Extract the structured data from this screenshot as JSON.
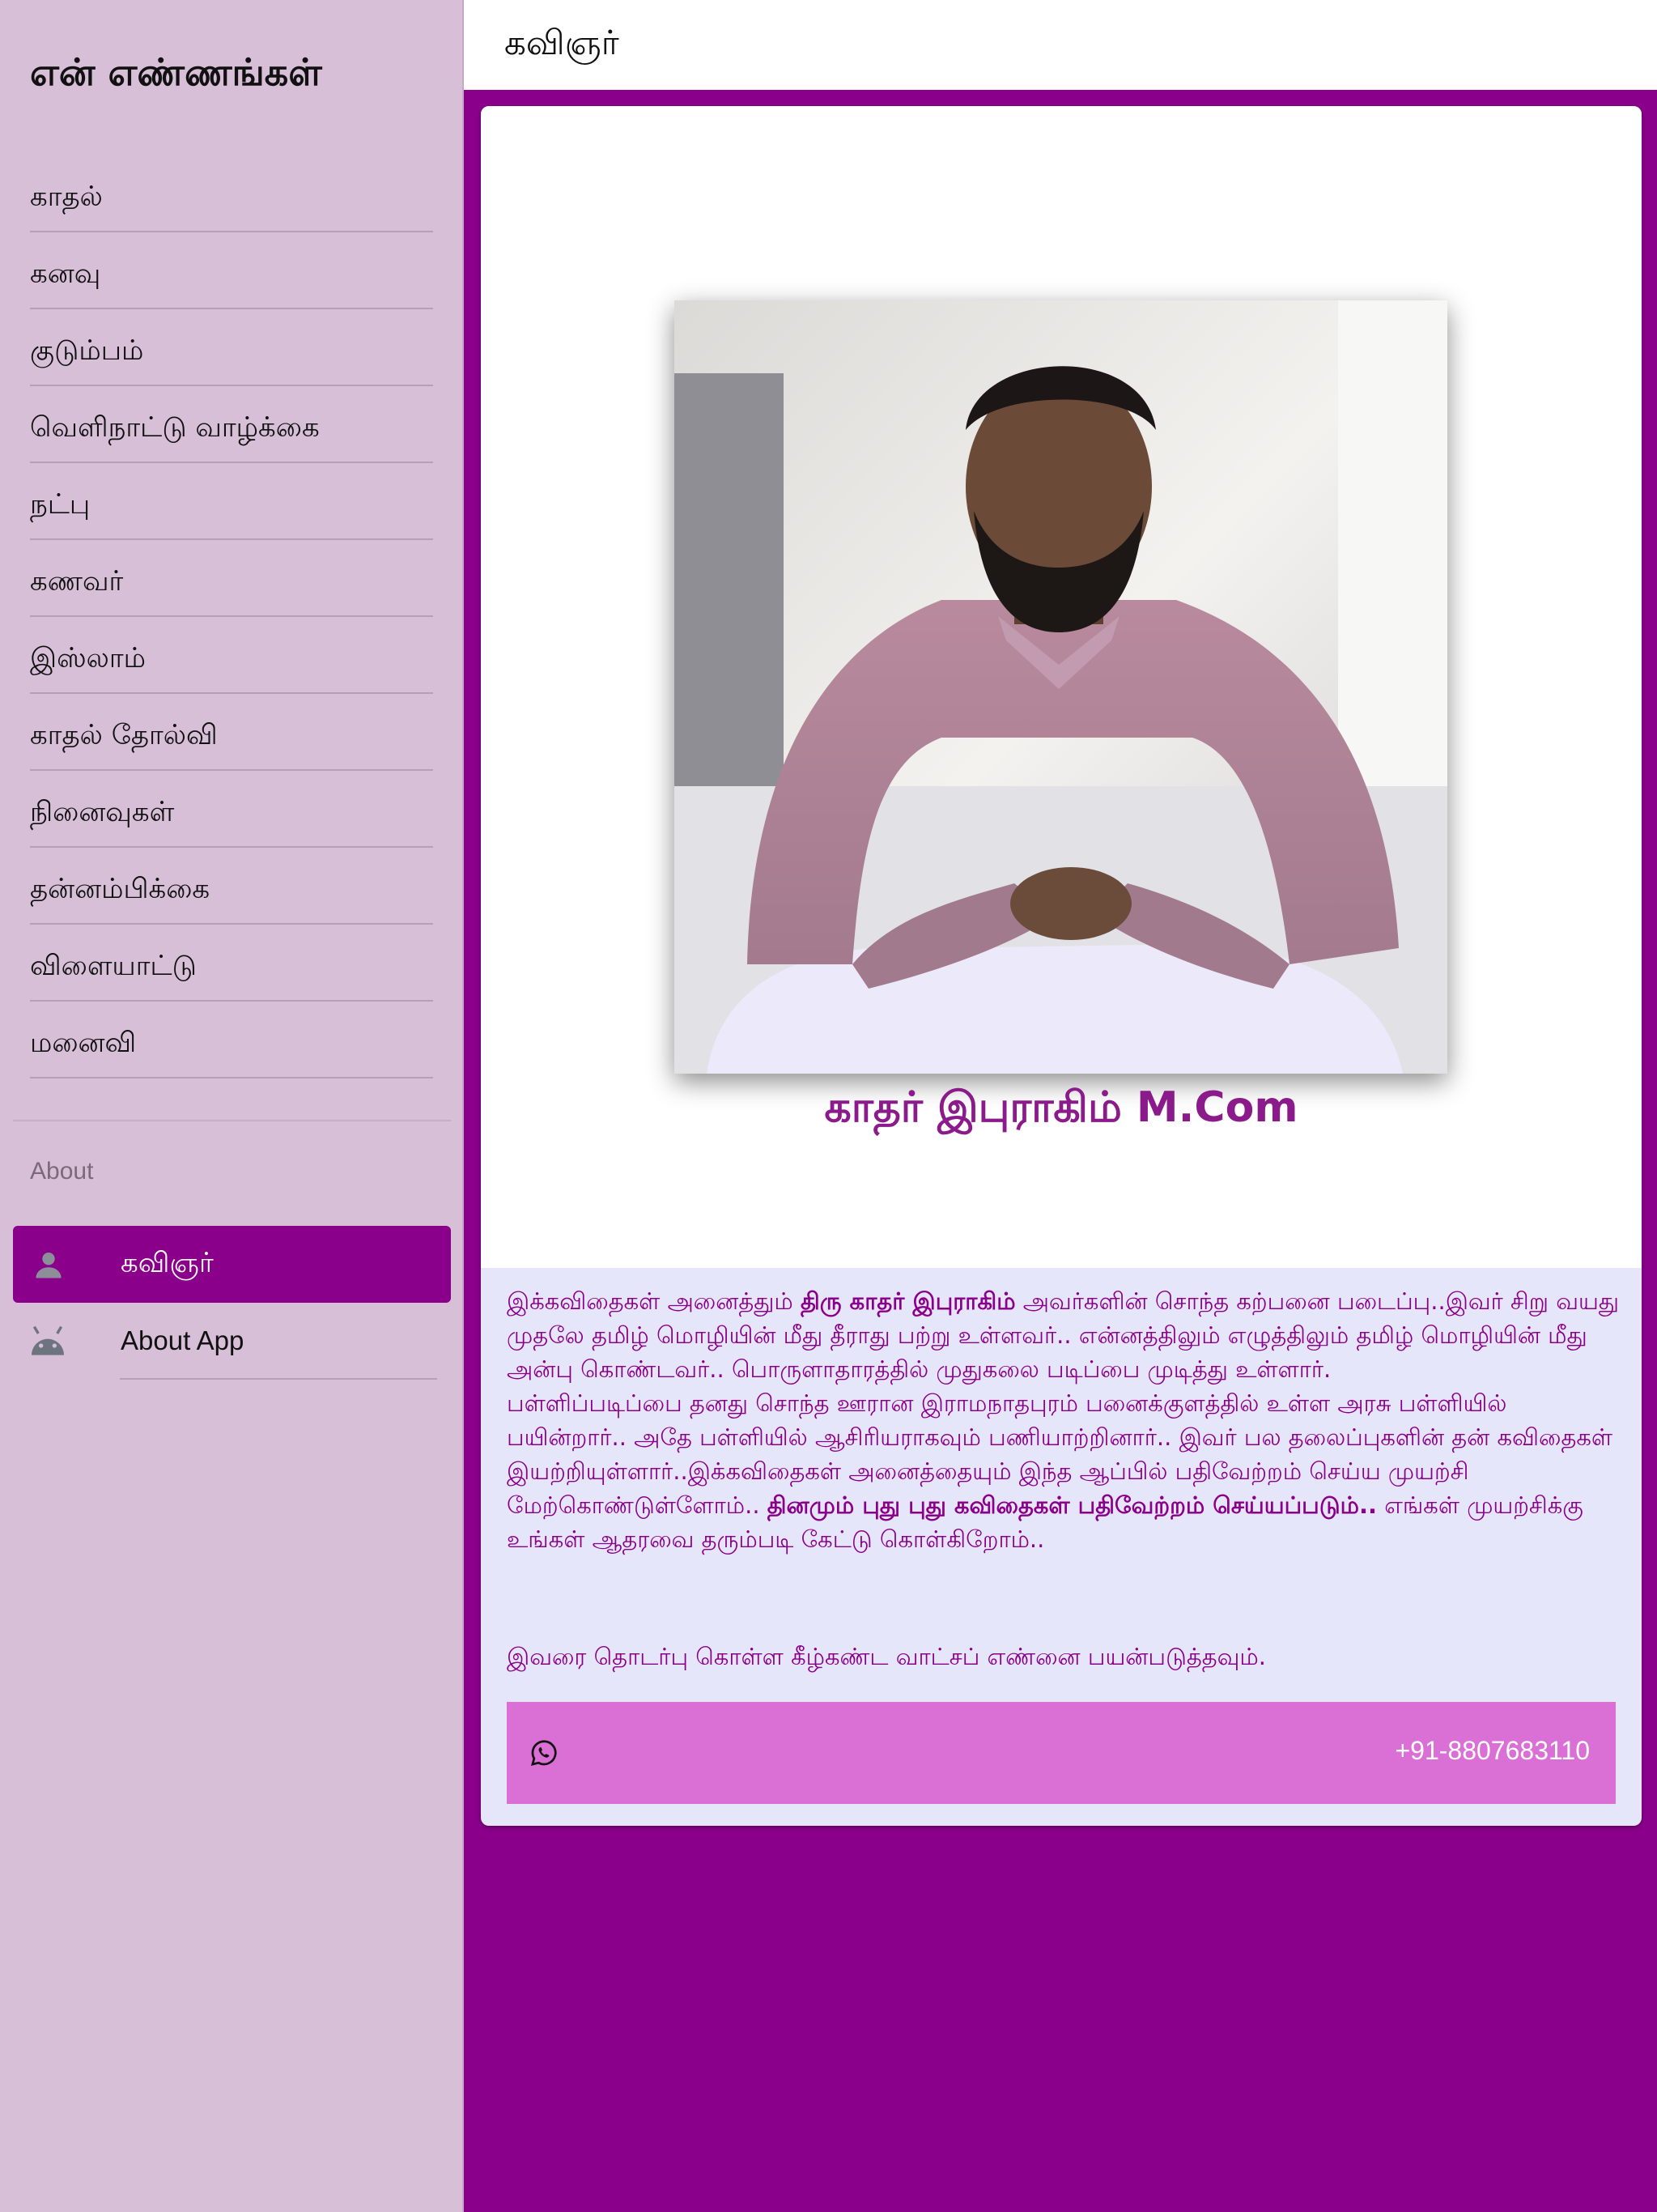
{
  "sidebar": {
    "app_title": "என் எண்ணங்கள்",
    "categories": [
      {
        "label": "காதல்"
      },
      {
        "label": "கனவு"
      },
      {
        "label": "குடும்பம்"
      },
      {
        "label": "வெளிநாட்டு வாழ்க்கை"
      },
      {
        "label": "நட்பு"
      },
      {
        "label": "கணவர்"
      },
      {
        "label": "இஸ்லாம்"
      },
      {
        "label": "காதல் தோல்வி"
      },
      {
        "label": "நினைவுகள்"
      },
      {
        "label": "தன்னம்பிக்கை"
      },
      {
        "label": "விளையாட்டு"
      },
      {
        "label": "மனைவி"
      }
    ],
    "about_header": "About",
    "nav": [
      {
        "label": "கவிஞர்",
        "icon": "person-icon",
        "active": true
      },
      {
        "label": "About App",
        "icon": "android-icon",
        "active": false
      }
    ]
  },
  "topbar": {
    "title": "கவிஞர்"
  },
  "profile": {
    "caption": "காதர் இபுராகிம் M.Com",
    "bio": {
      "p1_a": "இக்கவிதைகள் அனைத்தும் ",
      "p1_bold": "திரு காதர் இபுராகிம்",
      "p1_b": " அவர்களின் சொந்த கற்பனை படைப்பு..இவர் சிறு வயது முதலே தமிழ் மொழியின் மீது தீராது பற்று உள்ளவர்.. என்னத்திலும் எழுத்திலும் தமிழ் மொழியின் மீது அன்பு கொண்டவர்.. பொருளாதாரத்தில் முதுகலை படிப்பை முடித்து உள்ளார்.",
      "p2_a": "பள்ளிப்படிப்பை தனது சொந்த ஊரான இராமநாதபுரம் பனைக்குளத்தில் உள்ள அரசு பள்ளியில் பயின்றார்.. அதே பள்ளியில் ஆசிரியராகவும் பணியாற்றினார்.. இவர் பல தலைப்புகளின் தன் கவிதைகள் இயற்றியுள்ளார்..இக்கவிதைகள் அனைத்தையும் இந்த ஆப்பில் பதிவேற்றம் செய்ய முயற்சி மேற்கொண்டுள்ளோம்.. ",
      "p2_bold": "தினமும் புது புது கவிதைகள் பதிவேற்றம் செய்யப்படும்..",
      "p2_b": " எங்கள் முயற்சிக்கு உங்கள் ஆதரவை தரும்படி கேட்டு கொள்கிறோம்.."
    },
    "contact_note": "இவரை தொடர்பு கொள்ள கீழ்கண்ட வாட்சப் எண்னை பயன்படுத்தவும்.",
    "whatsapp": {
      "icon": "whatsapp-icon",
      "phone": "+91-8807683110"
    }
  },
  "colors": {
    "primary": "#8b008b",
    "sidebar_bg": "#d8bfd8",
    "card_bg": "#e6e6fa",
    "whatsapp_bar": "#da70d6"
  }
}
